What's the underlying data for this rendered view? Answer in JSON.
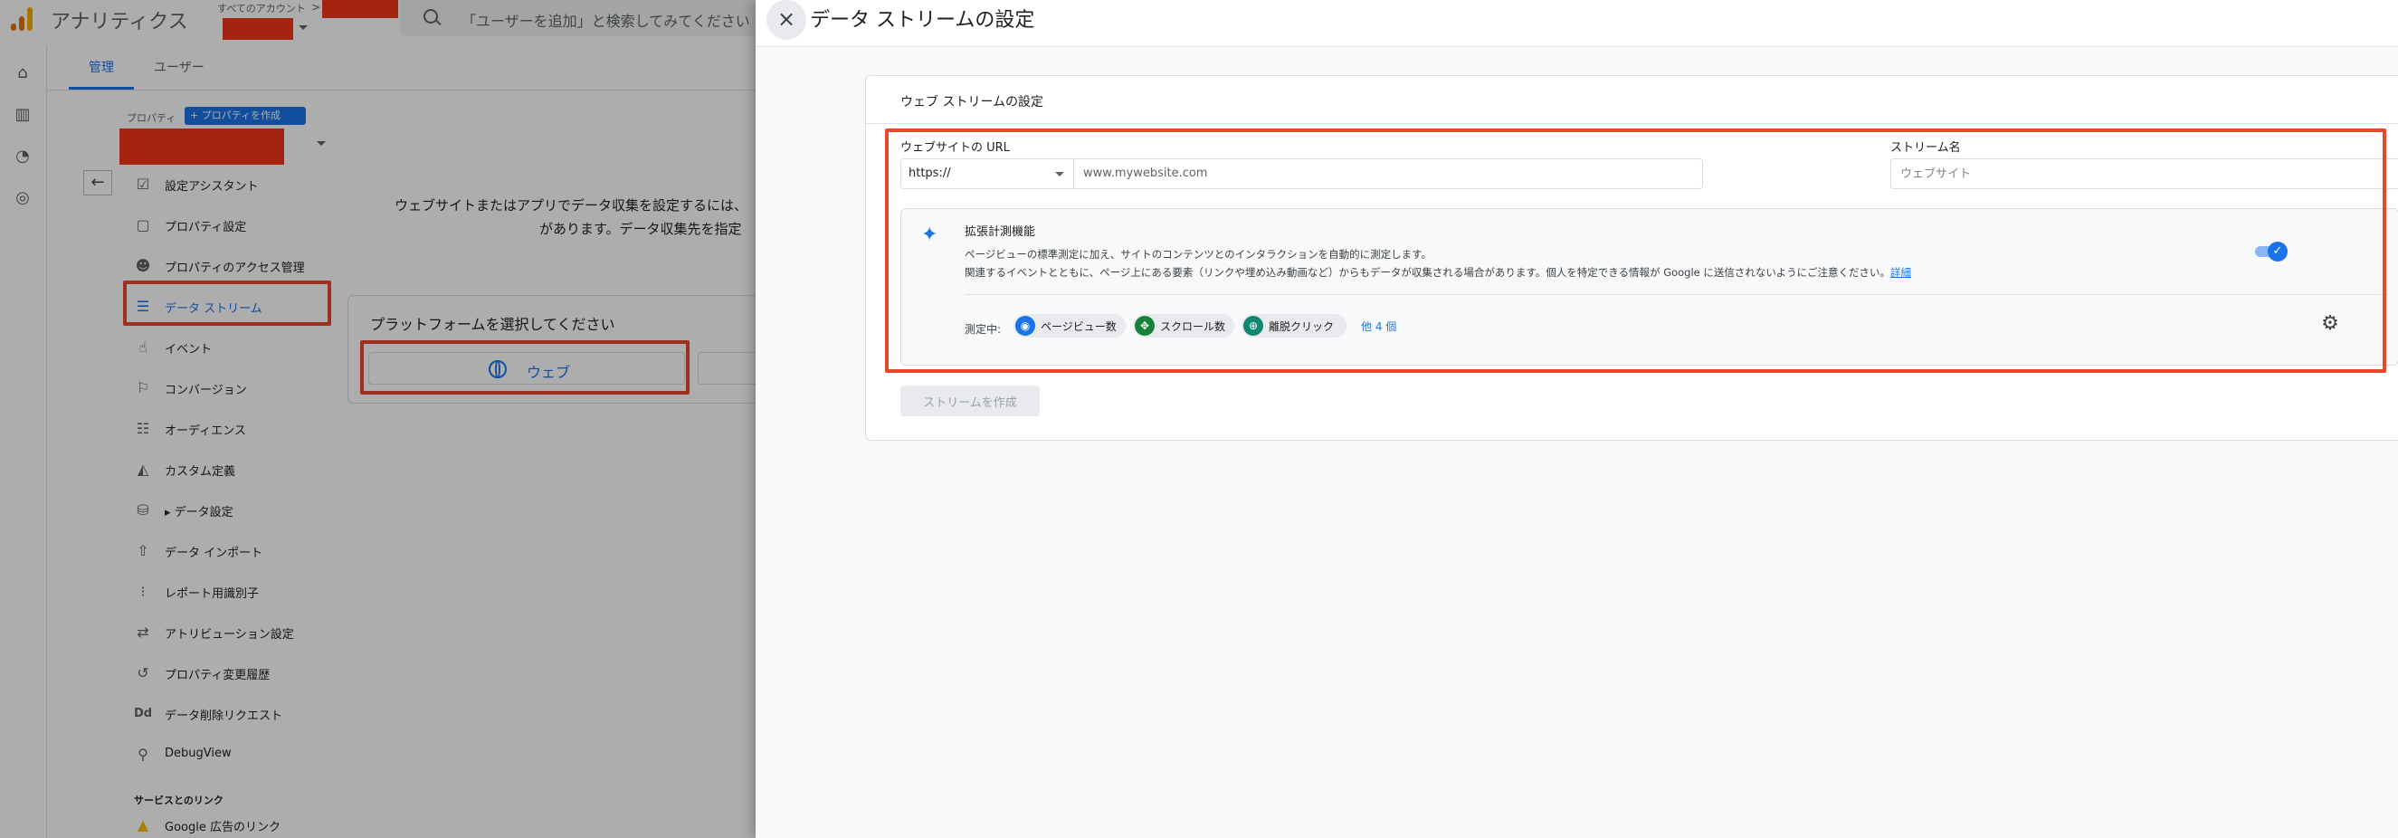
{
  "app": {
    "title": "アナリティクス",
    "account_label": "すべてのアカウント",
    "account_chevron": ">",
    "search_placeholder": "「ユーザーを追加」と検索してみてください"
  },
  "tabs": [
    {
      "label": "管理",
      "active": true
    },
    {
      "label": "ユーザー",
      "active": false
    }
  ],
  "property": {
    "label": "プロパティ",
    "create_button": "+ プロパティを作成"
  },
  "nav": {
    "items": [
      {
        "label": "設定アシスタント",
        "icon": "checkbox-icon"
      },
      {
        "label": "プロパティ設定",
        "icon": "property-icon"
      },
      {
        "label": "プロパティのアクセス管理",
        "icon": "people-icon"
      },
      {
        "label": "データ ストリーム",
        "icon": "stream-icon",
        "active": true
      },
      {
        "label": "イベント",
        "icon": "touch-icon"
      },
      {
        "label": "コンバージョン",
        "icon": "flag-icon"
      },
      {
        "label": "オーディエンス",
        "icon": "audience-icon"
      },
      {
        "label": "カスタム定義",
        "icon": "shapes-icon"
      },
      {
        "label": "データ設定",
        "icon": "database-icon",
        "expandable": true
      },
      {
        "label": "データ インポート",
        "icon": "upload-icon"
      },
      {
        "label": "レポート用識別子",
        "icon": "identifier-icon"
      },
      {
        "label": "アトリビューション設定",
        "icon": "attribution-icon"
      },
      {
        "label": "プロパティ変更履歴",
        "icon": "history-icon"
      },
      {
        "label": "データ削除リクエスト",
        "icon": "dd-icon"
      },
      {
        "label": "DebugView",
        "icon": "debug-icon"
      }
    ],
    "section_title": "サービスとのリンク",
    "links": [
      {
        "label": "Google 広告のリンク",
        "icon": "google-ads-icon"
      }
    ]
  },
  "main": {
    "message_line1": "ウェブサイトまたはアプリでデータ収集を設定するには、",
    "message_line2": "があります。データ収集先を指定",
    "platform_title": "プラットフォームを選択してください",
    "web_button": "ウェブ"
  },
  "panel": {
    "close_icon": "×",
    "title": "データ ストリームの設定",
    "card_title": "ウェブ ストリームの設定",
    "url_label": "ウェブサイトの URL",
    "protocol": "https://",
    "url_placeholder": "www.mywebsite.com",
    "stream_name_label": "ストリーム名",
    "stream_name_placeholder": "ウェブサイト",
    "enhanced": {
      "title": "拡張計測機能",
      "desc1": "ページビューの標準測定に加え、サイトのコンテンツとのインタラクションを自動的に測定します。",
      "desc2": "関連するイベントとともに、ページ上にある要素（リンクや埋め込み動画など）からもデータが収集される場合があります。個人を特定できる情報が Google に送信されないようにご注意ください。",
      "details_link": "詳細",
      "toggle_on": true,
      "measuring_label": "測定中:",
      "chips": [
        {
          "label": "ページビュー数",
          "color": "#1a73e8",
          "icon": "eye-icon"
        },
        {
          "label": "スクロール数",
          "color": "#188038",
          "icon": "scroll-icon"
        },
        {
          "label": "離脱クリック",
          "color": "#12876f",
          "icon": "lock-icon"
        }
      ],
      "more_label": "他 4 個"
    },
    "create_button": "ストリームを作成"
  },
  "colors": {
    "accent": "#1a73e8",
    "highlight": "#e8472e",
    "redaction": "#f2361b"
  }
}
